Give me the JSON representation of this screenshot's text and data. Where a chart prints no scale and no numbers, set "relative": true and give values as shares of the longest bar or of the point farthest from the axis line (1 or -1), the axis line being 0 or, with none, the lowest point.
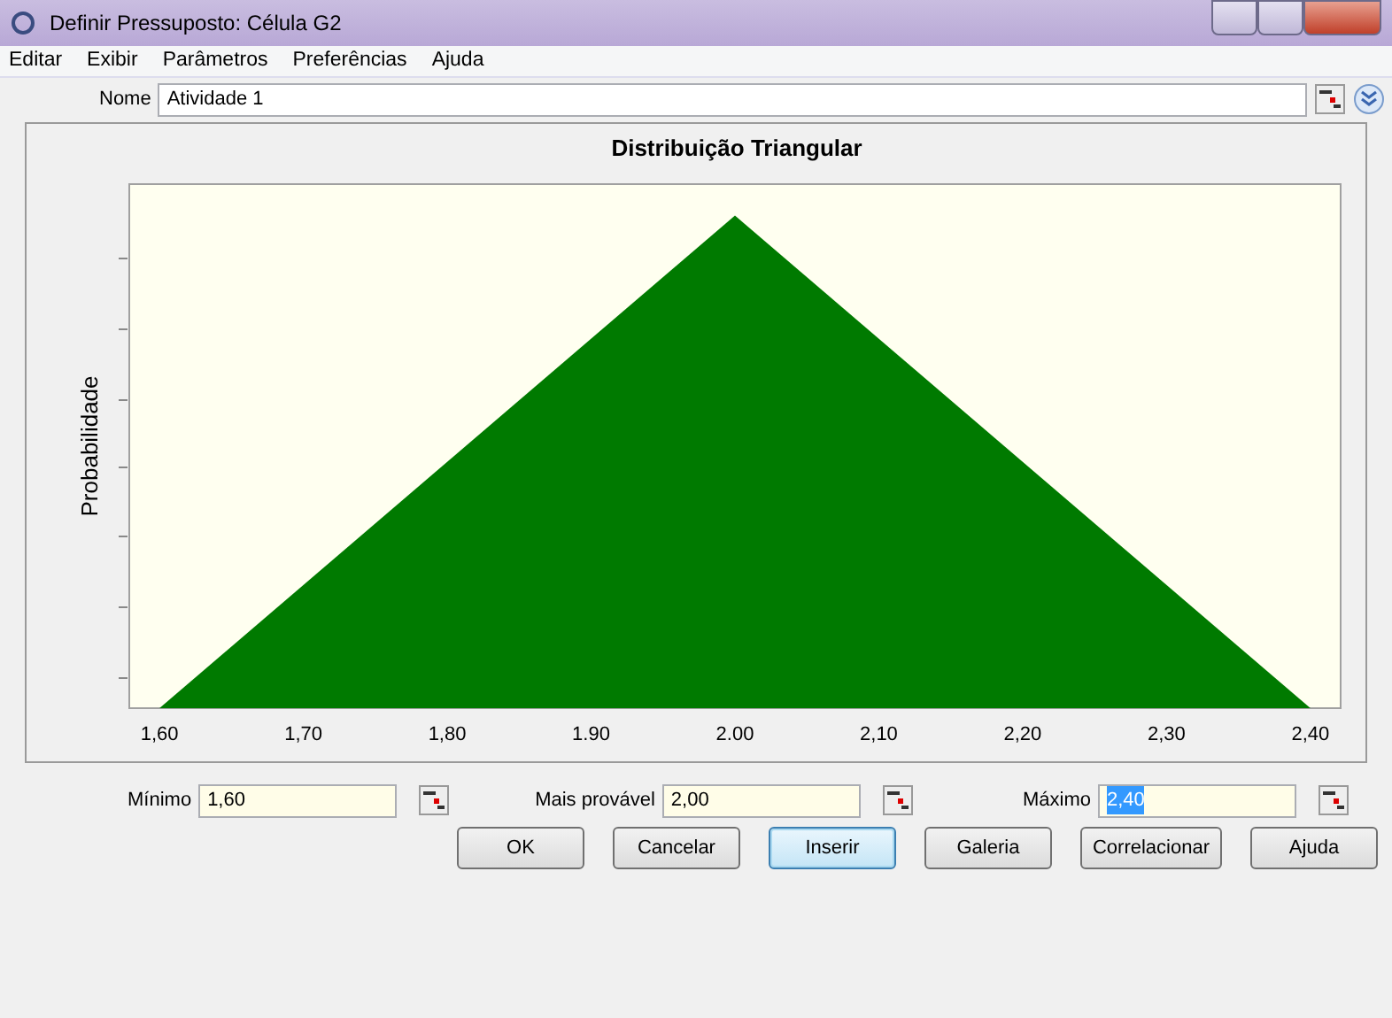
{
  "window": {
    "title": "Definir Pressuposto: Célula G2"
  },
  "menu": [
    "Editar",
    "Exibir",
    "Parâmetros",
    "Preferências",
    "Ajuda"
  ],
  "name_field": {
    "label": "Nome",
    "value": "Atividade 1"
  },
  "chart_data": {
    "type": "area",
    "title": "Distribuição Triangular",
    "ylabel": "Probabilidade",
    "x": [
      1.6,
      2.0,
      2.4
    ],
    "relative": true,
    "series": [
      {
        "color": "#007a00",
        "values": [
          0,
          1,
          0
        ]
      }
    ],
    "xlim": [
      1.579,
      2.421
    ],
    "xticks": [
      {
        "value": 1.6,
        "label": "1,60"
      },
      {
        "value": 1.7,
        "label": "1,70"
      },
      {
        "value": 1.8,
        "label": "1,80"
      },
      {
        "value": 1.9,
        "label": "1.90"
      },
      {
        "value": 2.0,
        "label": "2.00"
      },
      {
        "value": 2.1,
        "label": "2,10"
      },
      {
        "value": 2.2,
        "label": "2,20"
      },
      {
        "value": 2.3,
        "label": "2,30"
      },
      {
        "value": 2.4,
        "label": "2,40"
      }
    ]
  },
  "parameters": [
    {
      "label": "Mínimo",
      "value": "1,60",
      "selected": false
    },
    {
      "label": "Mais provável",
      "value": "2,00",
      "selected": false
    },
    {
      "label": "Máximo",
      "value": "2,40",
      "selected": true
    }
  ],
  "buttons": [
    {
      "label": "OK",
      "focused": false
    },
    {
      "label": "Cancelar",
      "focused": false
    },
    {
      "label": "Inserir",
      "focused": true
    },
    {
      "label": "Galeria",
      "focused": false
    },
    {
      "label": "Correlacionar",
      "focused": false
    },
    {
      "label": "Ajuda",
      "focused": false
    }
  ]
}
